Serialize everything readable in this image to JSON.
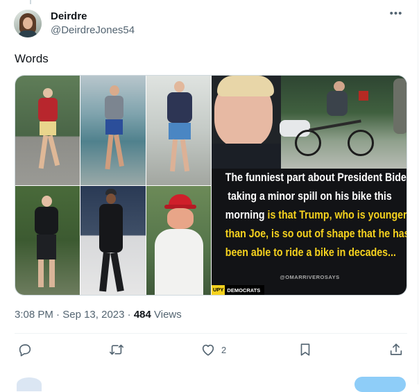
{
  "author": {
    "display_name": "Deirdre",
    "handle": "@DeirdreJones54"
  },
  "tweet": {
    "text": "Words"
  },
  "media": {
    "meme_lines": [
      [
        {
          "t": "The funniest part about President Biden",
          "c": "white"
        }
      ],
      [
        {
          "t": "taking a minor spill on his bike this",
          "c": "white"
        }
      ],
      [
        {
          "t": "morning ",
          "c": "white"
        },
        {
          "t": "is that Trump, who is younger",
          "c": "yellow"
        }
      ],
      [
        {
          "t": "than Joe, is so out of shape that he hasn't",
          "c": "yellow"
        }
      ],
      [
        {
          "t": "been able to ride a bike in decades...",
          "c": "yellow"
        }
      ]
    ],
    "credit": "@OMARRIVEROSAYS",
    "badge_tag": "UPY",
    "badge_text": "DEMOCRATS"
  },
  "meta": {
    "time": "3:08 PM",
    "separator": "·",
    "date": "Sep 13, 2023",
    "views_count": "484",
    "views_label": "Views"
  },
  "actions": {
    "like_count": "2"
  },
  "icons": {
    "more": "more-horizontal-icon",
    "reply": "reply-icon",
    "retweet": "retweet-icon",
    "like": "heart-icon",
    "bookmark": "bookmark-icon",
    "share": "share-icon"
  },
  "colors": {
    "text_primary": "#0f1419",
    "text_secondary": "#536471",
    "meme_yellow": "#f6d21e",
    "meme_bg": "#121316"
  }
}
